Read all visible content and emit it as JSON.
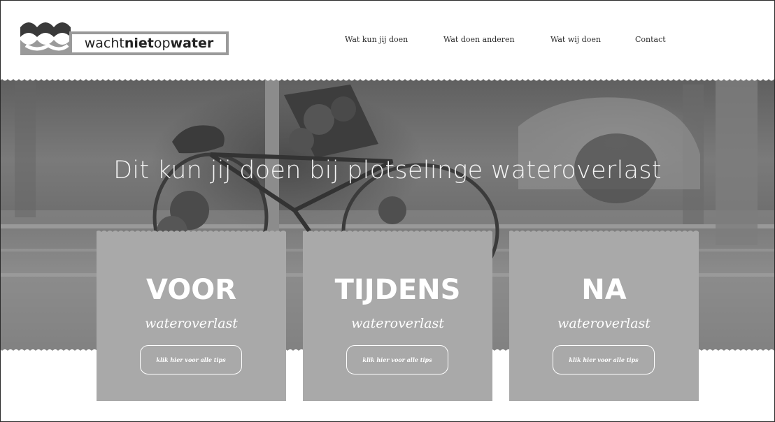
{
  "logo": {
    "part1": "wacht",
    "part2": "niet",
    "part3": "op",
    "part4": "water"
  },
  "nav": {
    "items": [
      {
        "label": "Wat kun jij doen"
      },
      {
        "label": "Wat doen anderen"
      },
      {
        "label": "Wat wij doen"
      },
      {
        "label": "Contact"
      }
    ]
  },
  "hero": {
    "title": "Dit kun jij doen bij plotselinge wateroverlast"
  },
  "cards": [
    {
      "title": "VOOR",
      "subtitle": "wateroverlast",
      "button": "klik hier voor alle tips"
    },
    {
      "title": "TIJDENS",
      "subtitle": "wateroverlast",
      "button": "klik hier voor alle tips"
    },
    {
      "title": "NA",
      "subtitle": "wateroverlast",
      "button": "klik hier voor alle tips"
    }
  ],
  "colors": {
    "card_bg": "#a9a9a9",
    "logo_frame": "#9a9a9a",
    "text_dark": "#2b2b2b"
  }
}
